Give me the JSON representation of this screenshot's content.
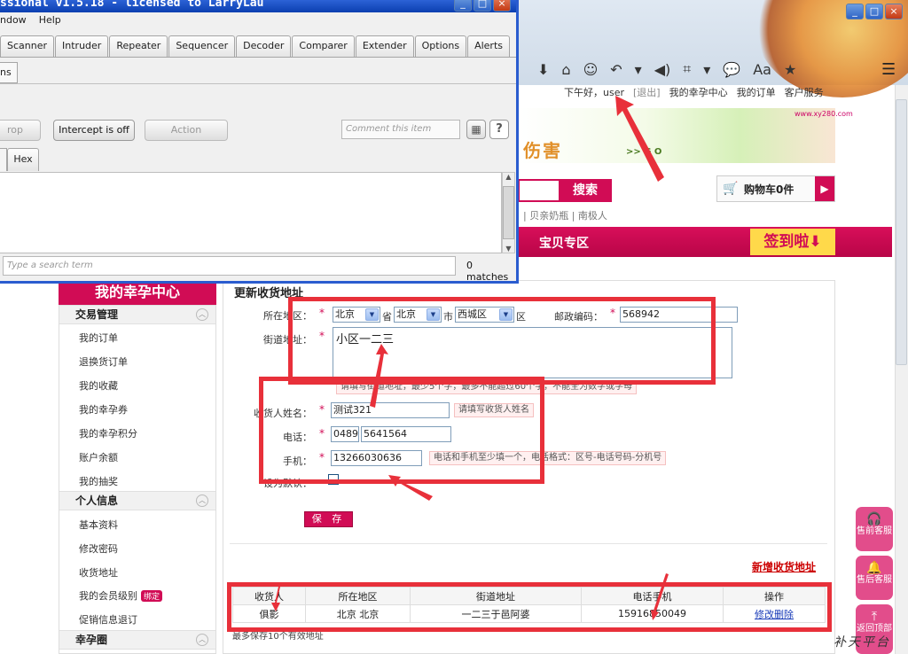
{
  "browser": {
    "window_controls": [
      "_",
      "□",
      "×"
    ],
    "toolbar_icons": [
      "download-icon",
      "home-icon",
      "smiley-icon",
      "back-icon",
      "dropdown-icon",
      "speaker-icon",
      "crop-icon",
      "dropdown-icon",
      "chat-icon",
      "reader-icon",
      "star-icon"
    ],
    "toolbar_glyphs": [
      "⬇",
      "⌂",
      "☺",
      "↶",
      "▾",
      "◀)",
      "⌗",
      "▾",
      "💬",
      "Aa",
      "★"
    ],
    "menu_glyph": "☰"
  },
  "site": {
    "topnav": {
      "greeting": "下午好，user",
      "logout": "[退出]",
      "items": [
        "我的幸孕中心",
        "我的订单",
        "客户服务"
      ]
    },
    "banner": {
      "text": "伤害",
      "go": ">> G O",
      "url": "www.xy280.com"
    },
    "search_button": "搜索",
    "hot_words": "| 贝亲奶瓶 | 南极人",
    "cart_label": "购物车0件",
    "cart_arrow": "▶",
    "nav_item": "宝贝专区",
    "signin_banner": "签到啦⬇",
    "colors": {
      "brand": "#d10c55",
      "annotation": "#e8303a"
    }
  },
  "sidebar": {
    "title": "我的幸孕中心",
    "sections": [
      {
        "label": "交易管理",
        "items": [
          "我的订单",
          "退换货订单",
          "我的收藏",
          "我的幸孕券",
          "我的幸孕积分",
          "账户余额",
          "我的抽奖"
        ]
      },
      {
        "label": "个人信息",
        "items": [
          "基本资料",
          "修改密码",
          "收货地址",
          "我的会员级别",
          "促销信息退订"
        ]
      },
      {
        "label": "幸孕圈",
        "items": []
      }
    ],
    "badge": "绑定",
    "toggle_glyph": "︿"
  },
  "form": {
    "title": "更新收货地址",
    "region_label": "所在地区：",
    "province": "北京",
    "province_suffix": "省",
    "city": "北京",
    "city_suffix": "市",
    "district": "西城区",
    "district_suffix": "区",
    "zip_label": "邮政编码：",
    "zip_value": "568942",
    "street_label": "街道地址：",
    "street_value": "小区一二三",
    "street_tip": "请填写街道地址，最少5个字，最多不能超过60个字，不能全为数字或字母",
    "name_label": "收货人姓名：",
    "name_value": "测试321",
    "name_tip": "请填写收货人姓名",
    "phone_label": "电话：",
    "phone_area": "0489",
    "phone_number": "5641564",
    "mobile_label": "手机：",
    "mobile_value": "13266030636",
    "mobile_tip": "电话和手机至少填一个，电话格式：区号-电话号码-分机号",
    "default_label": "设为默认：",
    "required_mark": "*",
    "save_button": "保 存",
    "new_address_link": "新增收货地址"
  },
  "address_table": {
    "headers": [
      "收货人",
      "所在地区",
      "街道地址",
      "电话手机",
      "操作"
    ],
    "rows": [
      {
        "name": "俱影",
        "region": "北京 北京",
        "street": "一二三于邑阿婆",
        "phone": "15916850049",
        "edit": "修改",
        "delete": "删除"
      }
    ],
    "footnote": "最多保存10个有效地址"
  },
  "float_service": [
    {
      "label": "售前客服",
      "icon": "headset-icon",
      "glyph": "🎧"
    },
    {
      "label": "售后客服",
      "icon": "bell-icon",
      "glyph": "🔔"
    },
    {
      "label": "返回顶部",
      "icon": "top-icon",
      "glyph": "⤒"
    }
  ],
  "watermark": "补天平台",
  "burp": {
    "title": "ssional v1.5.18 - licensed to LarryLau",
    "menu": [
      "ndow",
      "Help"
    ],
    "tabs": [
      "Scanner",
      "Intruder",
      "Repeater",
      "Sequencer",
      "Decoder",
      "Comparer",
      "Extender",
      "Options",
      "Alerts"
    ],
    "subtab": "ns",
    "buttons": {
      "drop": "rop",
      "intercept": "Intercept is off",
      "action": "Action"
    },
    "comment_placeholder": "Comment this item",
    "grid_glyph": "▦",
    "help": "?",
    "hex_tab": "Hex",
    "scroll_up": "▲",
    "scroll_down": "▼",
    "search_placeholder": "Type a search term",
    "matches": "0 matches"
  }
}
